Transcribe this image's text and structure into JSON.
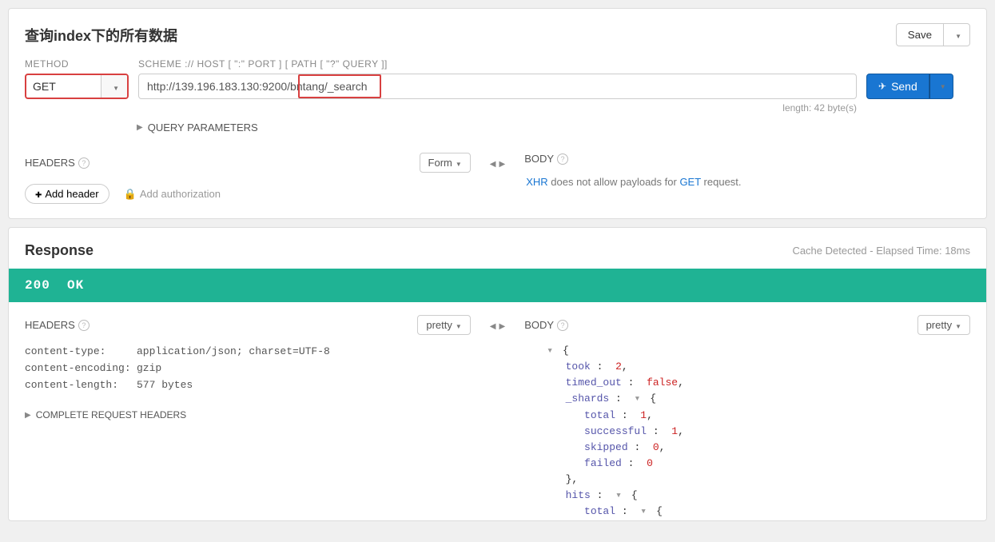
{
  "request": {
    "title": "查询index下的所有数据",
    "save_label": "Save",
    "method_label": "METHOD",
    "method_value": "GET",
    "scheme_label": "SCHEME :// HOST [ \":\" PORT ] [ PATH [ \"?\" QUERY ]]",
    "url_value": "http://139.196.183.130:9200/bntang/_search",
    "length_info": "length: 42 byte(s)",
    "send_label": "Send",
    "query_params_label": "QUERY PARAMETERS",
    "headers_label": "HEADERS",
    "form_label": "Form",
    "add_header_label": "Add header",
    "add_auth_label": "Add authorization",
    "body_label": "BODY",
    "xhr_note_prefix": "XHR",
    "xhr_note_mid": " does not allow payloads for ",
    "xhr_note_method": "GET",
    "xhr_note_suffix": " request."
  },
  "response": {
    "title": "Response",
    "cache_info": "Cache Detected - Elapsed Time: 18ms",
    "status_code": "200",
    "status_text": "OK",
    "headers_label": "HEADERS",
    "pretty_label": "pretty",
    "body_label": "BODY",
    "pretty_body_label": "pretty",
    "complete_headers_label": "COMPLETE REQUEST HEADERS",
    "headers": [
      {
        "k": "content-type:",
        "v": "application/json; charset=UTF-8"
      },
      {
        "k": "content-encoding:",
        "v": "gzip"
      },
      {
        "k": "content-length:",
        "v": "577 bytes"
      }
    ],
    "json_lines": [
      {
        "indent": 0,
        "toggle": true,
        "html": "<span class='jpunc'>{</span>"
      },
      {
        "indent": 1,
        "html": "<span class='jkey'>took</span> <span class='jpunc'>:</span>  <span class='jnum'>2</span><span class='jpunc'>,</span>"
      },
      {
        "indent": 1,
        "html": "<span class='jkey'>timed_out</span> <span class='jpunc'>:</span>  <span class='jbool'>false</span><span class='jpunc'>,</span>"
      },
      {
        "indent": 1,
        "toggle": true,
        "html": "<span class='jkey'>_shards</span> <span class='jpunc'>:</span>  <span class='toggle'>▾</span> <span class='jpunc'>{</span>"
      },
      {
        "indent": 2,
        "html": "<span class='jkey'>total</span> <span class='jpunc'>:</span>  <span class='jnum'>1</span><span class='jpunc'>,</span>"
      },
      {
        "indent": 2,
        "html": "<span class='jkey'>successful</span> <span class='jpunc'>:</span>  <span class='jnum'>1</span><span class='jpunc'>,</span>"
      },
      {
        "indent": 2,
        "html": "<span class='jkey'>skipped</span> <span class='jpunc'>:</span>  <span class='jnum'>0</span><span class='jpunc'>,</span>"
      },
      {
        "indent": 2,
        "html": "<span class='jkey'>failed</span> <span class='jpunc'>:</span>  <span class='jnum'>0</span>"
      },
      {
        "indent": 1,
        "html": "<span class='jpunc'>},</span>"
      },
      {
        "indent": 1,
        "toggle": true,
        "html": "<span class='jkey'>hits</span> <span class='jpunc'>:</span>  <span class='toggle'>▾</span> <span class='jpunc'>{</span>"
      },
      {
        "indent": 2,
        "toggle": true,
        "html": "<span class='jkey'>total</span> <span class='jpunc'>:</span>  <span class='toggle'>▾</span> <span class='jpunc'>{</span>"
      }
    ]
  }
}
